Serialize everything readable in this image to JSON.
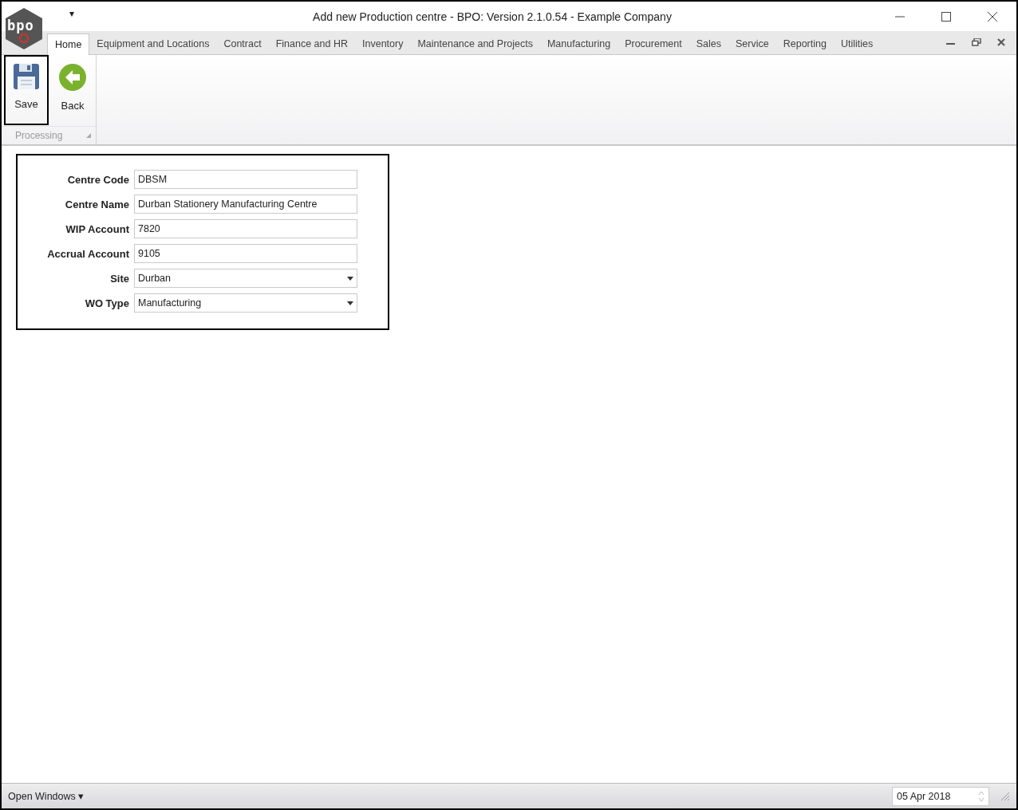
{
  "window": {
    "title": "Add new Production centre - BPO: Version 2.1.0.54 - Example Company",
    "logo_text": "bpo",
    "quick_access": "▾"
  },
  "tabs": [
    {
      "label": "Home",
      "selected": true
    },
    {
      "label": "Equipment and Locations",
      "selected": false
    },
    {
      "label": "Contract",
      "selected": false
    },
    {
      "label": "Finance and HR",
      "selected": false
    },
    {
      "label": "Inventory",
      "selected": false
    },
    {
      "label": "Maintenance and Projects",
      "selected": false
    },
    {
      "label": "Manufacturing",
      "selected": false
    },
    {
      "label": "Procurement",
      "selected": false
    },
    {
      "label": "Sales",
      "selected": false
    },
    {
      "label": "Service",
      "selected": false
    },
    {
      "label": "Reporting",
      "selected": false
    },
    {
      "label": "Utilities",
      "selected": false
    }
  ],
  "ribbon": {
    "buttons": [
      {
        "label": "Save",
        "kind": "save",
        "highlighted": true
      },
      {
        "label": "Back",
        "kind": "back",
        "highlighted": false
      }
    ],
    "group": "Processing"
  },
  "form": {
    "fields": [
      {
        "label": "Centre Code",
        "value": "DBSM",
        "kind": "text"
      },
      {
        "label": "Centre Name",
        "value": "Durban Stationery Manufacturing Centre",
        "kind": "text"
      },
      {
        "label": "WIP Account",
        "value": "7820",
        "kind": "text"
      },
      {
        "label": "Accrual Account",
        "value": "9105",
        "kind": "text"
      },
      {
        "label": "Site",
        "value": "Durban",
        "kind": "dropdown"
      },
      {
        "label": "WO Type",
        "value": "Manufacturing",
        "kind": "dropdown"
      }
    ]
  },
  "status_bar": {
    "open_windows": "Open Windows ▾",
    "date": "05 Apr 2018"
  }
}
